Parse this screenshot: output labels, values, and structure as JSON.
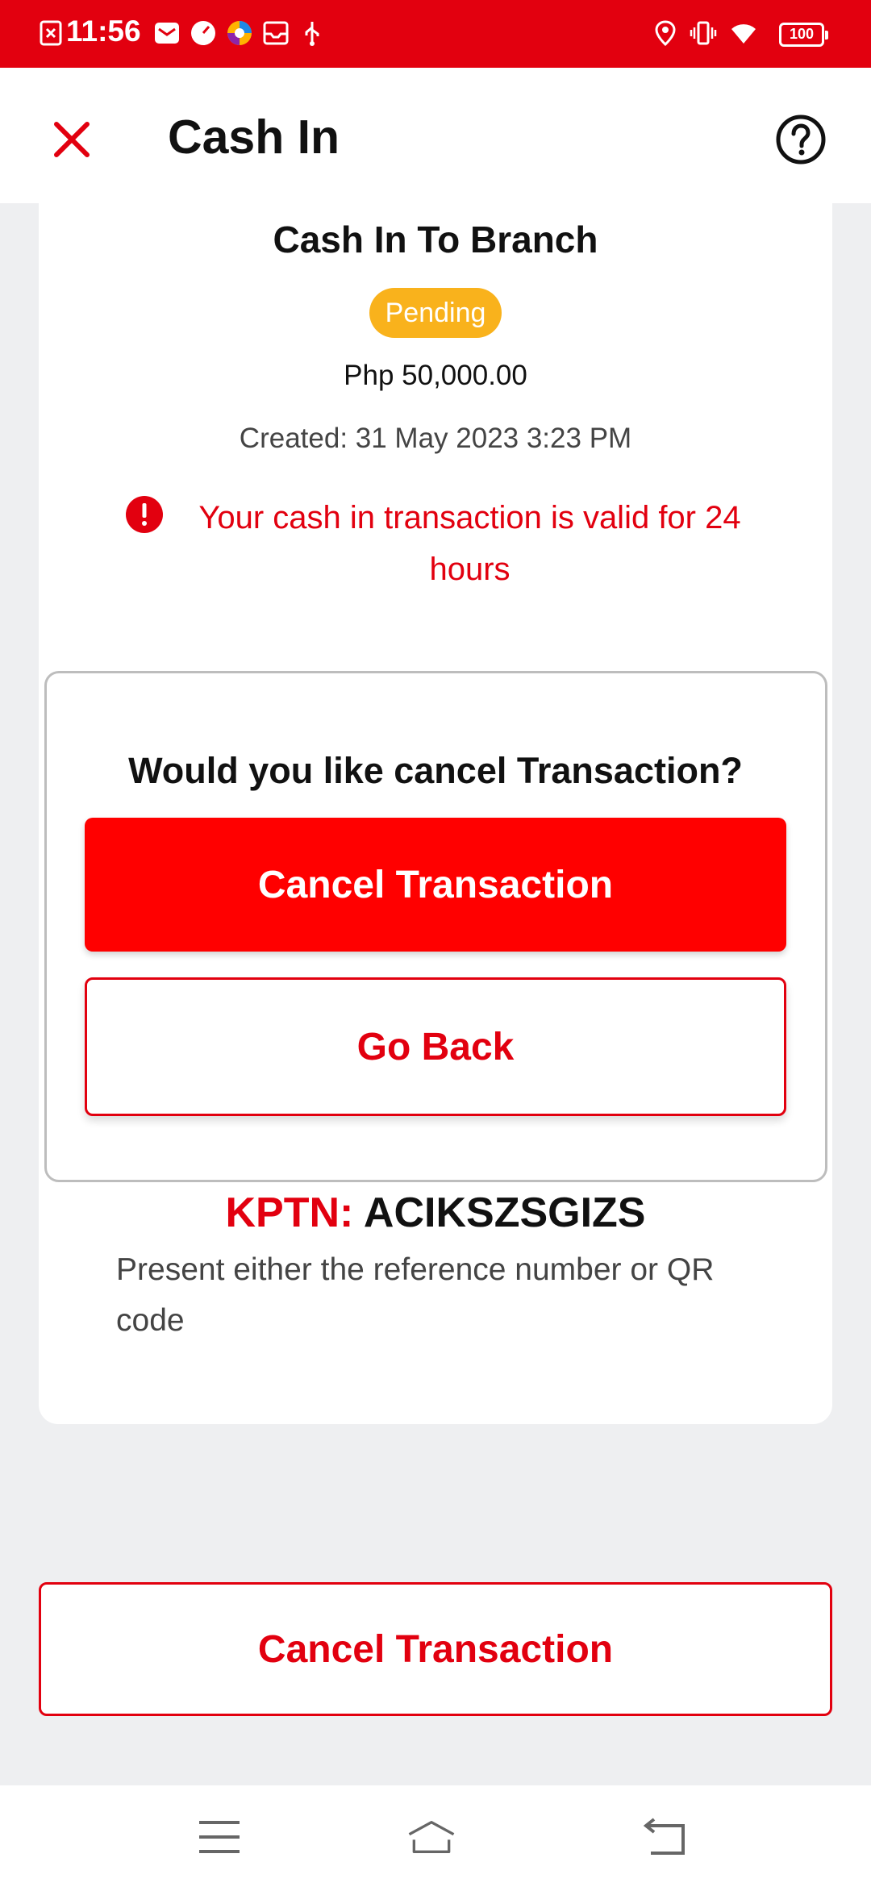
{
  "status_bar": {
    "time": "11:56",
    "battery": "100",
    "left_icons": [
      "screenshot-icon",
      "mail-icon",
      "speed-icon",
      "browser-icon",
      "inbox-icon",
      "usb-icon"
    ],
    "right_icons": [
      "location-icon",
      "vibrate-icon",
      "wifi-icon",
      "battery-icon"
    ]
  },
  "header": {
    "title": "Cash In",
    "close_icon": "close-icon",
    "help_icon": "help-icon"
  },
  "transaction": {
    "title": "Cash In To Branch",
    "status": "Pending",
    "amount": "Php 50,000.00",
    "created": "Created: 31 May 2023 3:23 PM",
    "warning": "Your cash in transaction is valid for 24 hours"
  },
  "dialog": {
    "question": "Would you like cancel Transaction?",
    "confirm_label": "Cancel Transaction",
    "back_label": "Go Back"
  },
  "reference": {
    "kptn_label": "KPTN:",
    "kptn_value": "ACIKSZSGIZS",
    "instruction": "Present either the reference number or QR code"
  },
  "bottom_button": {
    "label": "Cancel Transaction"
  },
  "colors": {
    "brand_red": "#e2000f",
    "button_red": "#ff0000",
    "pending": "#f9b21c",
    "background": "#eeeff1"
  }
}
